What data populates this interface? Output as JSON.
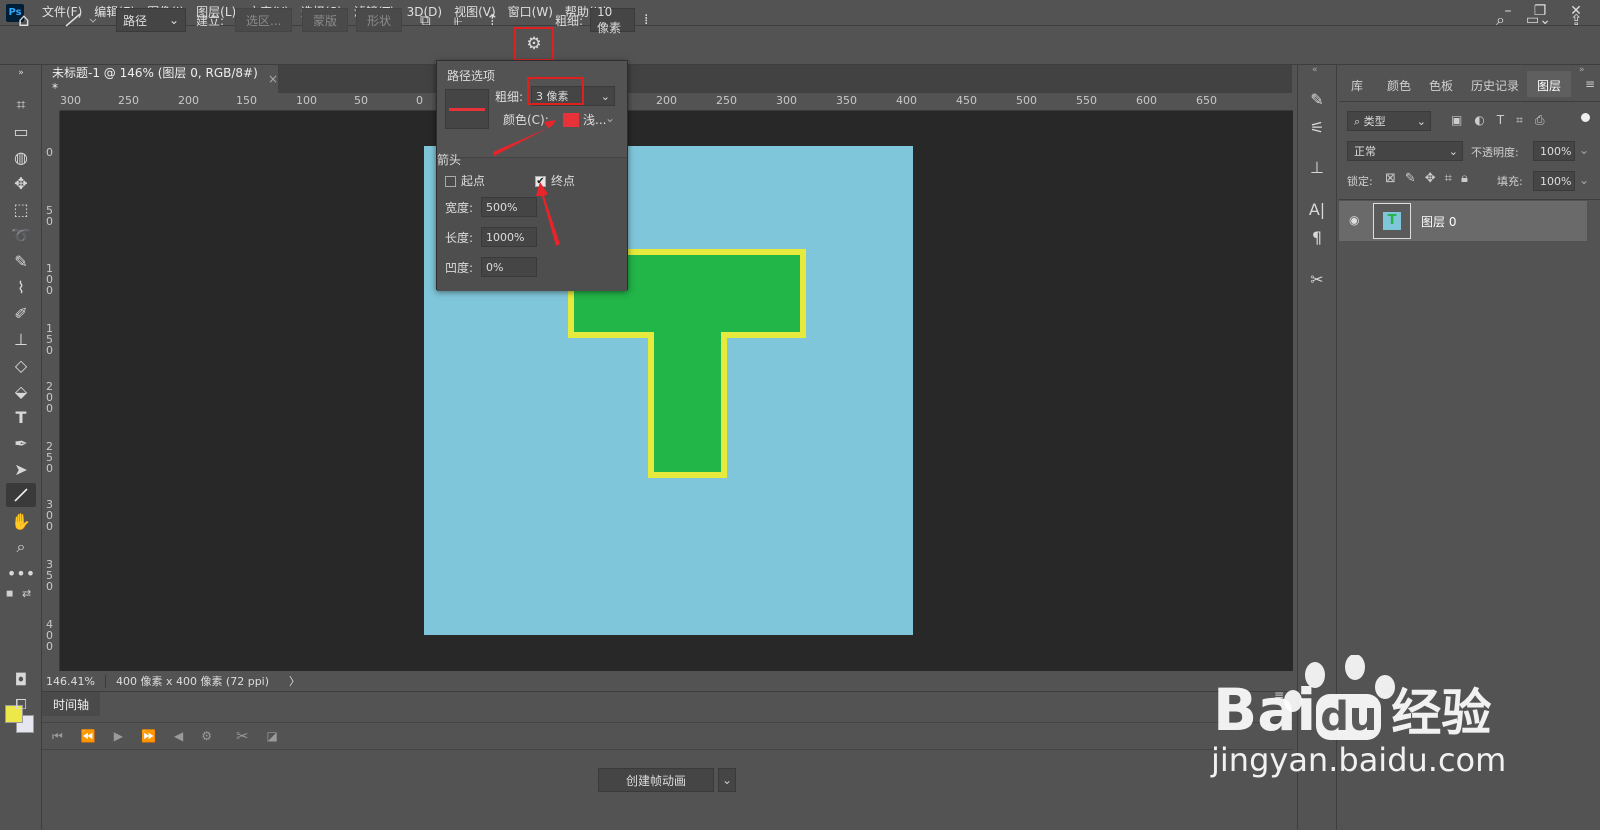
{
  "app": {
    "logo": "Ps"
  },
  "menu": [
    "文件(F)",
    "编辑(E)",
    "图像(I)",
    "图层(L)",
    "文字(Y)",
    "选择(S)",
    "滤镜(T)",
    "3D(D)",
    "视图(V)",
    "窗口(W)",
    "帮助(H)"
  ],
  "options": {
    "mode": "路径",
    "make_label": "建立:",
    "btn_selection": "选区...",
    "btn_mask": "蒙版",
    "btn_shape": "形状",
    "weight_label": "粗细:",
    "weight_value": "10 像素"
  },
  "doc_tab": {
    "title": "未标题-1 @ 146% (图层 0, RGB/8#) *",
    "close": "×"
  },
  "ruler_h": [
    "300",
    "250",
    "200",
    "150",
    "100",
    "50",
    "0",
    "200",
    "250",
    "300",
    "350",
    "400",
    "450",
    "500",
    "550",
    "600",
    "650"
  ],
  "ruler_v": [
    "0",
    "5\n0",
    "1\n0\n0",
    "1\n5\n0",
    "2\n0\n0",
    "2\n5\n0",
    "3\n0\n0",
    "3\n5\n0",
    "4\n0\n0"
  ],
  "path_options": {
    "title": "路径选项",
    "weight_label": "粗细:",
    "weight_value": "3 像素",
    "color_label": "颜色(C):",
    "color_value": "浅...",
    "color_swatch": "#e8323a",
    "arrow_header": "箭头",
    "start_label": "起点",
    "end_label": "终点",
    "start_checked": false,
    "end_checked": true,
    "width_label": "宽度:",
    "width_value": "500%",
    "length_label": "长度:",
    "length_value": "1000%",
    "concavity_label": "凹度:",
    "concavity_value": "0%"
  },
  "canvas": {
    "bg": "#80c6da",
    "shape_fill": "#22b548",
    "shape_stroke": "#e6ea3c"
  },
  "status": {
    "zoom": "146.41%",
    "size": "400 像素 x 400 像素 (72 ppi)",
    "arrow": "〉"
  },
  "timeline": {
    "title": "时间轴",
    "create_btn": "创建帧动画"
  },
  "right_tabs": [
    "库",
    "颜色",
    "色板",
    "历史记录",
    "图层"
  ],
  "layers": {
    "filter": "类型",
    "blend": "正常",
    "opacity_label": "不透明度:",
    "opacity_value": "100%",
    "lock_label": "锁定:",
    "fill_label": "填充:",
    "fill_value": "100%",
    "layer_name": "图层 0"
  },
  "watermark": {
    "brand1": "Bai",
    "brand2": "du",
    "brand3": "经验",
    "url": "jingyan.baidu.com"
  }
}
